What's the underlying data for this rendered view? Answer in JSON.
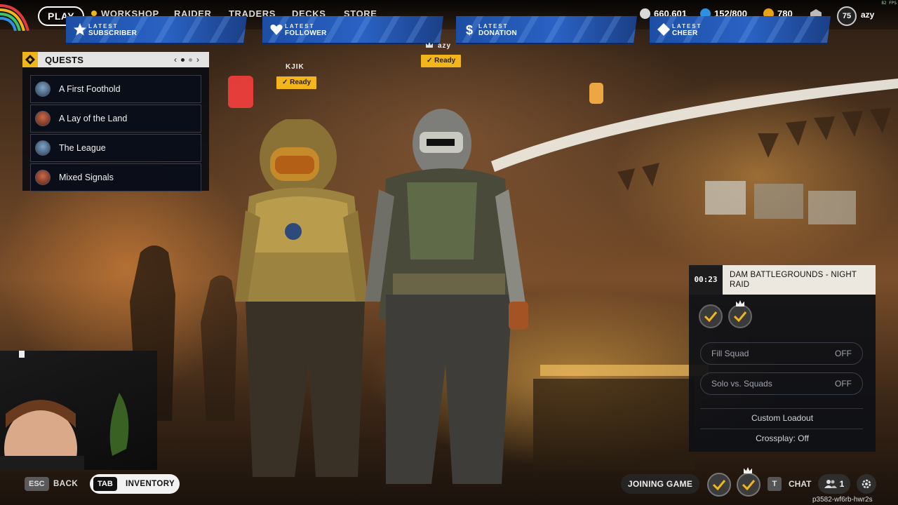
{
  "nav": {
    "play": "PLAY",
    "items": [
      "WORKSHOP",
      "RAIDER",
      "TRADERS",
      "DECKS",
      "STORE"
    ],
    "currencies": [
      {
        "value": "660,601",
        "icon": "coin-icon",
        "color": "#d8d8d8"
      },
      {
        "value": "152/800",
        "icon": "raider-token-icon",
        "color": "#2f8fe0"
      },
      {
        "value": "780",
        "icon": "credit-icon",
        "color": "#e8a21a"
      }
    ],
    "level": "75",
    "username": "azy",
    "fps": "82 FPS"
  },
  "banners": [
    {
      "line1": "LATEST",
      "line2": "SUBSCRIBER",
      "icon": "star-icon"
    },
    {
      "line1": "LATEST",
      "line2": "FOLLOWER",
      "icon": "heart-icon"
    },
    {
      "line1": "LATEST",
      "line2": "DONATION",
      "icon": "dollar-icon"
    },
    {
      "line1": "LATEST",
      "line2": "CHEER",
      "icon": "diamond-icon"
    }
  ],
  "quests": {
    "title": "QUESTS",
    "prev": "‹",
    "next": "›",
    "items": [
      "A First Foothold",
      "A Lay of the Land",
      "The League",
      "Mixed Signals"
    ]
  },
  "players": [
    {
      "name": "KJIK",
      "status": "Ready"
    },
    {
      "name": "azy",
      "status": "Ready"
    }
  ],
  "bottom": {
    "esc_key": "ESC",
    "back_label": "BACK",
    "tab_key": "TAB",
    "inventory_label": "INVENTORY",
    "joining": "JOINING GAME",
    "chat_key": "T",
    "chat_label": "CHAT",
    "friends_count": "1",
    "session_id": "p3582-wf6rb-hwr2s"
  },
  "matchmaking": {
    "timer": "00:23",
    "map": "DAM BATTLEGROUNDS - NIGHT RAID",
    "fill_squad_label": "Fill Squad",
    "fill_squad_value": "OFF",
    "solo_label": "Solo vs. Squads",
    "solo_value": "OFF",
    "custom_loadout": "Custom Loadout",
    "crossplay": "Crossplay: Off"
  },
  "colors": {
    "accent_yellow": "#f2b61c",
    "banner_blue": "#2a62c4",
    "panel_dark": "#0e1016"
  }
}
